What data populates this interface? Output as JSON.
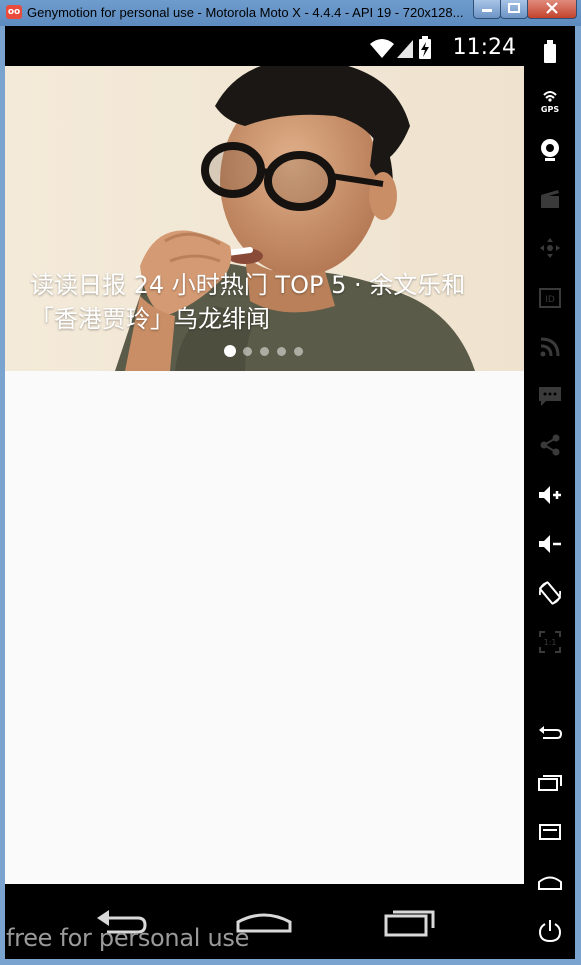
{
  "window": {
    "app_icon": "genymotion-icon",
    "title": "Genymotion for personal use - Motorola Moto X - 4.4.4 - API 19 - 720x128...",
    "minimize_label": "▭",
    "maximize_label": "□",
    "close_label": "✕"
  },
  "statusbar": {
    "time": "11:24",
    "icons": [
      "wifi-icon",
      "signal-icon",
      "battery-charging-icon"
    ]
  },
  "hero": {
    "headline": "读读日报 24 小时热门 TOP 5 · 余文乐和「香港贾玲」乌龙绯闻",
    "page_count": 5,
    "active_page": 1
  },
  "navbar": {
    "buttons": [
      "back-icon",
      "home-icon",
      "recent-apps-icon"
    ],
    "watermark": "free for personal use"
  },
  "sidebar": {
    "buttons": [
      {
        "icon": "battery-icon"
      },
      {
        "icon": "gps-icon",
        "label": "GPS"
      },
      {
        "icon": "webcam-icon"
      },
      {
        "icon": "screencast-icon"
      },
      {
        "icon": "dpad-icon"
      },
      {
        "icon": "id-icon",
        "label": "ID"
      },
      {
        "icon": "rss-icon"
      },
      {
        "icon": "sms-icon"
      },
      {
        "icon": "share-icon"
      },
      {
        "icon": "volume-up-icon"
      },
      {
        "icon": "volume-down-icon"
      },
      {
        "icon": "rotate-icon"
      },
      {
        "icon": "pixel-perfect-icon",
        "label": "1:1"
      },
      {
        "icon": "back-icon"
      },
      {
        "icon": "recent-apps-icon"
      },
      {
        "icon": "menu-icon"
      },
      {
        "icon": "home-icon"
      },
      {
        "icon": "power-icon"
      }
    ]
  },
  "colors": {
    "titlebar": "#6e9ccd",
    "content_bg": "#fafafa",
    "hero_bg": "#f2e7d7",
    "shirt": "#5b5b49"
  }
}
